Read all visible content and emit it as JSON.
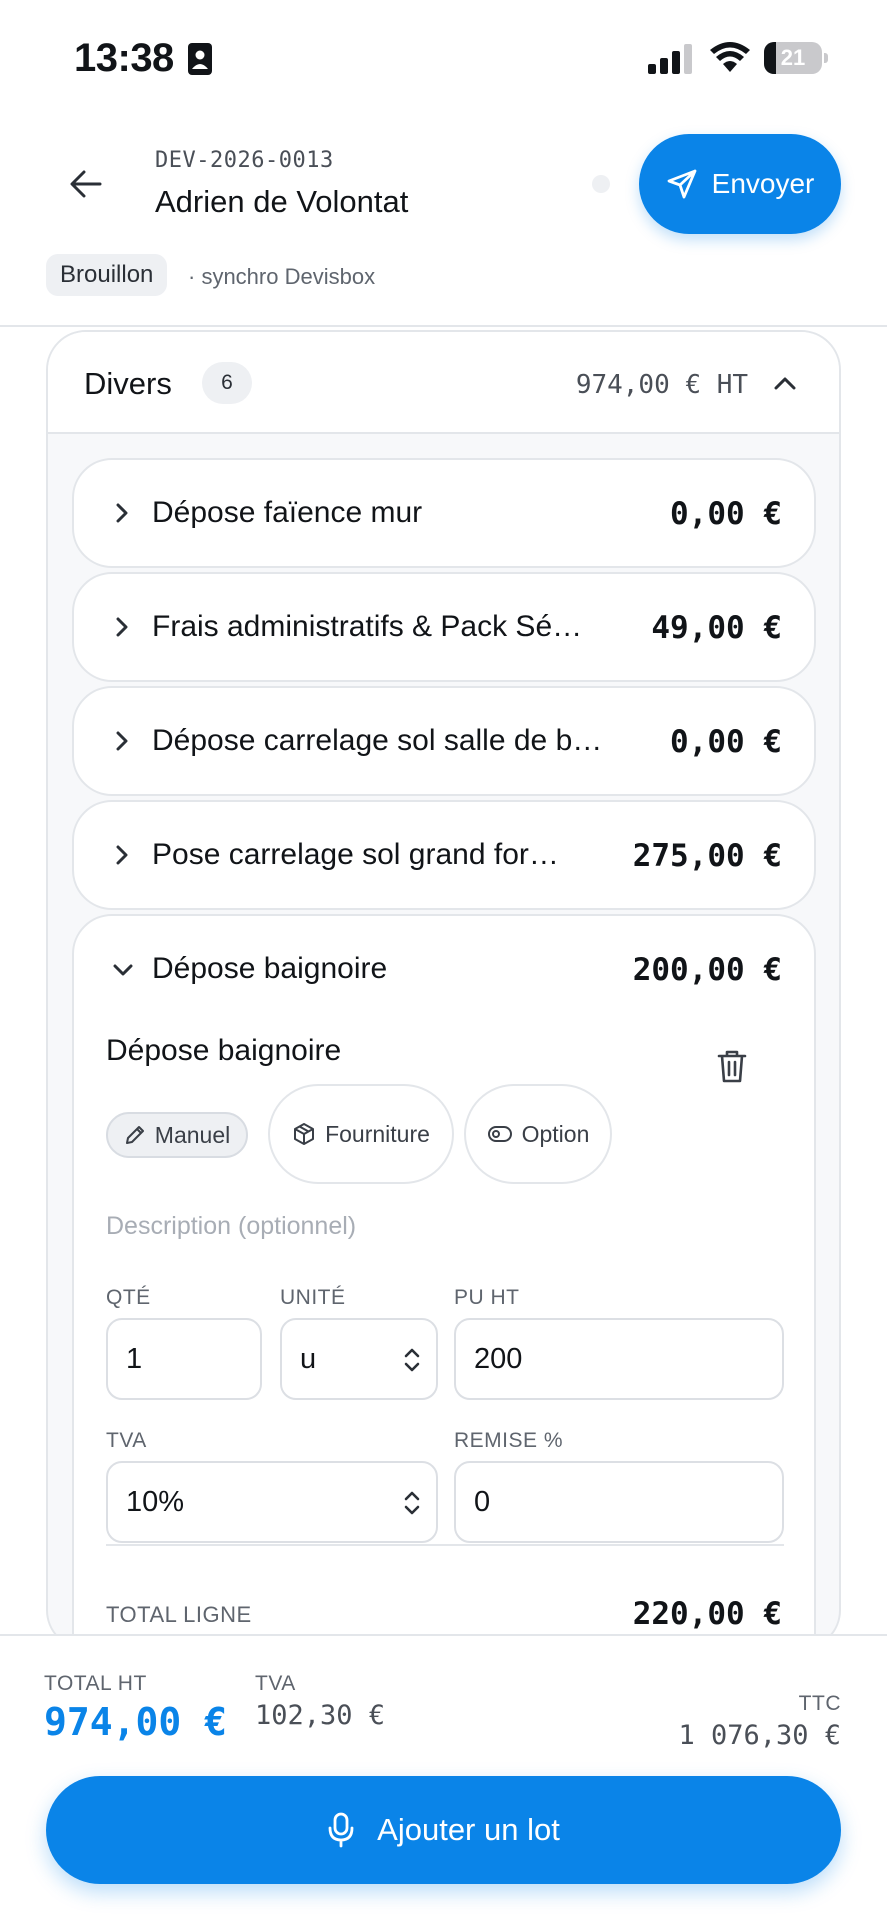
{
  "status_bar": {
    "time": "13:38",
    "battery_level": "21",
    "battery_fraction": 0.21
  },
  "header": {
    "doc_number": "DEV-2026-0013",
    "client_name": "Adrien de Volontat",
    "send_label": "Envoyer",
    "status_badge": "Brouillon",
    "sync_text": "· synchro Devisbox"
  },
  "lot": {
    "title": "Divers",
    "count": "6",
    "total_ht": "974,00 € HT",
    "lines": [
      {
        "label": "Dépose faïence mur",
        "amount": "0,00 €"
      },
      {
        "label": "Frais administratifs & Pack Sé…",
        "amount": "49,00 €"
      },
      {
        "label": "Dépose carrelage sol salle de b…",
        "amount": "0,00 €"
      },
      {
        "label": "Pose carrelage sol grand for…",
        "amount": "275,00 €"
      }
    ],
    "expanded_line": {
      "label": "Dépose baignoire",
      "amount": "200,00 €",
      "detail_title": "Dépose baignoire",
      "chips": {
        "manuel": "Manuel",
        "fourniture": "Fourniture",
        "option": "Option"
      },
      "description_placeholder": "Description (optionnel)",
      "fields": {
        "qty_label": "QTÉ",
        "qty_value": "1",
        "unit_label": "UNITÉ",
        "unit_value": "u",
        "pu_label": "PU HT",
        "pu_value": "200",
        "tva_label": "TVA",
        "tva_value": "10%",
        "remise_label": "REMISE %",
        "remise_value": "0"
      },
      "total_label": "TOTAL LIGNE",
      "total_value": "220,00 €"
    }
  },
  "footer": {
    "ht_label": "TOTAL HT",
    "ht_value": "974,00 €",
    "tva_label": "TVA",
    "tva_value": "102,30 €",
    "ttc_label": "TTC",
    "ttc_value": "1 076,30 €",
    "add_lot_label": "Ajouter un lot"
  },
  "colors": {
    "accent": "#0a84e8",
    "border": "#e3e6ea",
    "text": "#111418"
  },
  "icons": [
    "id-card-icon",
    "signal-icon",
    "wifi-icon",
    "battery-icon",
    "back-arrow-icon",
    "send-icon",
    "chevron-up-icon",
    "chevron-right-icon",
    "chevron-down-icon",
    "trash-icon",
    "pencil-icon",
    "box-icon",
    "eye-icon",
    "select-arrows-icon",
    "microphone-icon"
  ]
}
